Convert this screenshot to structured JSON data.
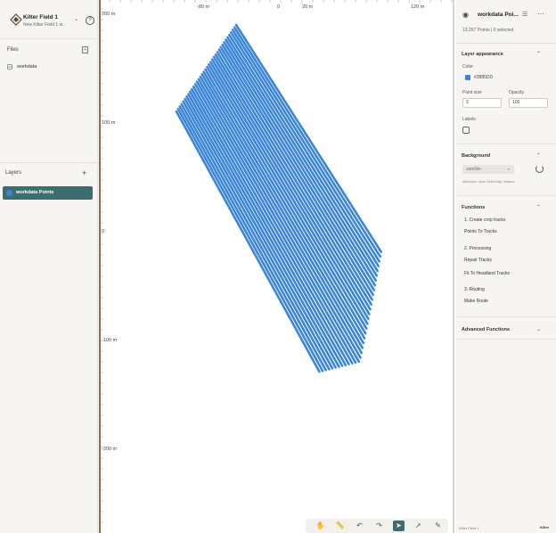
{
  "project": {
    "title": "Kilter Field 1",
    "subtitle": "New Kilter Field 1 w..."
  },
  "files": {
    "heading": "Files",
    "items": [
      {
        "type_tag": "csv",
        "label": "workdata"
      }
    ]
  },
  "layers": {
    "heading": "Layers",
    "items": [
      {
        "label": "workdata Points",
        "color": "#3a85d8"
      }
    ]
  },
  "map": {
    "x_ticks": [
      "-80 m",
      "0",
      "20 m",
      "120 m"
    ],
    "y_ticks": [
      "200 m",
      "100 m",
      "0",
      "-100 m",
      "-200 m"
    ],
    "point_color": "#3a85d8",
    "track_count": 36
  },
  "toolbar": {
    "tools": [
      {
        "name": "pan-hand-icon",
        "glyph": "✋",
        "active": false
      },
      {
        "name": "measure-ruler-icon",
        "glyph": "📏",
        "active": false
      },
      {
        "name": "undo-icon",
        "glyph": "↶",
        "active": false
      },
      {
        "name": "redo-icon",
        "glyph": "↷",
        "active": false
      },
      {
        "name": "select-cursor-icon",
        "glyph": "➤",
        "active": true
      },
      {
        "name": "draw-path-icon",
        "glyph": "➚",
        "active": false
      },
      {
        "name": "draw-polygon-icon",
        "glyph": "✎",
        "active": false
      }
    ]
  },
  "panel": {
    "title": "workdata Poi...",
    "count": "13,267 Points | 0 selected",
    "appearance": {
      "heading": "Layer appearance",
      "color_label": "Color",
      "color_value": "#3885DD",
      "point_size_label": "Point size",
      "point_size_value": "3",
      "opacity_label": "Opacity",
      "opacity_value": "100",
      "labels_label": "Labels"
    },
    "background": {
      "heading": "Background",
      "selected": "satellite",
      "attribution": "Attribution: Open Street Map, Mapbox"
    },
    "functions": {
      "heading": "Functions",
      "items": [
        "1. Create crop tracks",
        "Points To Tracks",
        "2. Processing",
        "Repair Tracks",
        "Fit To Headland Tracks",
        "3. Routing",
        "Make Route"
      ]
    },
    "advanced": {
      "heading": "Advanced Functions"
    },
    "footer_name": "Kilter Field 1",
    "footer_brand": "Kilter"
  }
}
